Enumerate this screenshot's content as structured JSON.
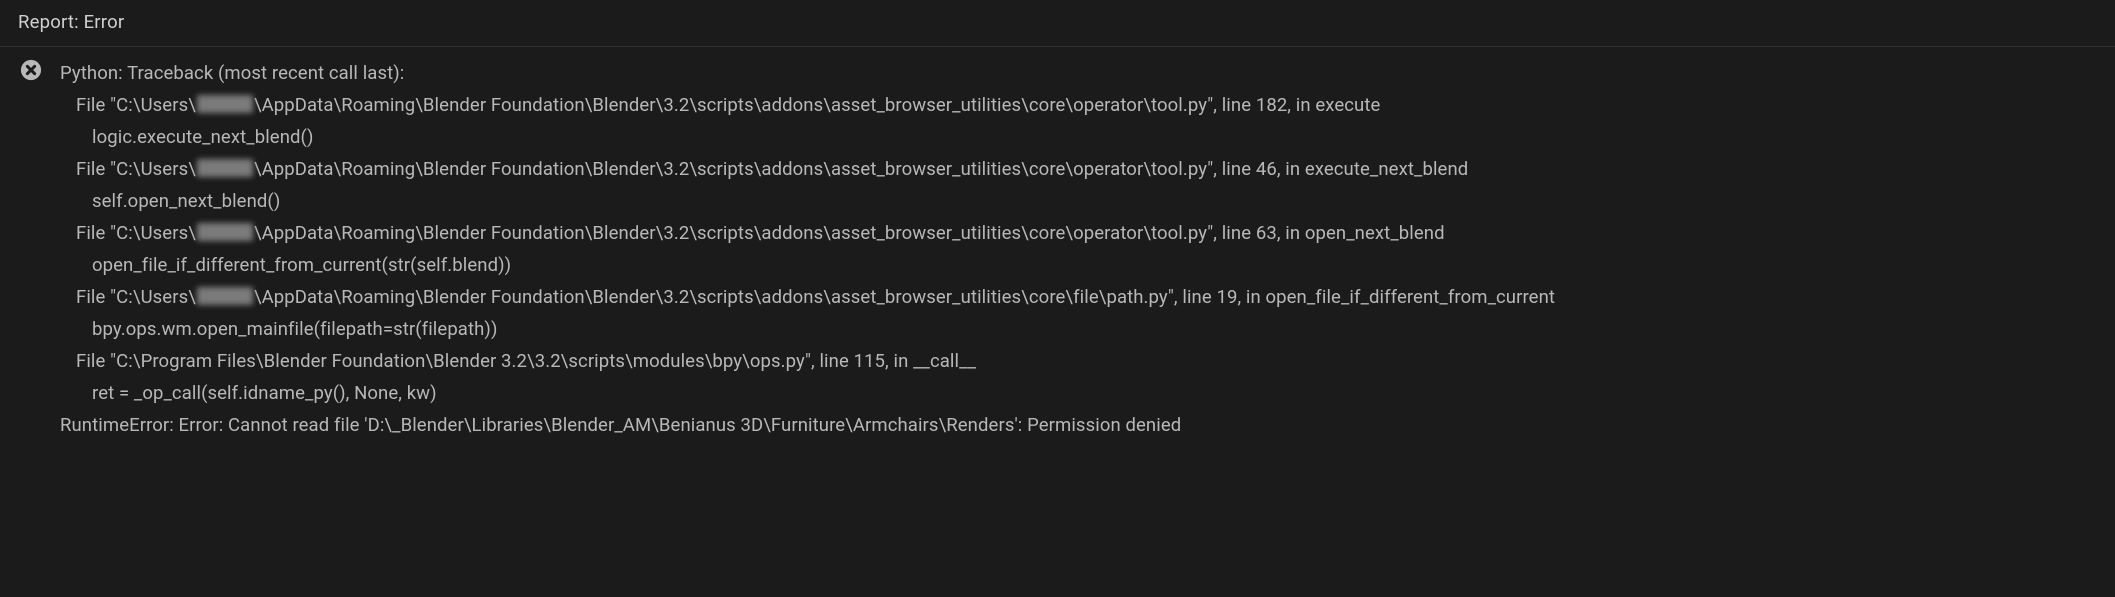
{
  "header": {
    "title": "Report: Error"
  },
  "message": {
    "icon": "error-circle-x-icon",
    "lines": [
      {
        "indent": 0,
        "segments": [
          "Python: Traceback (most recent call last):"
        ]
      },
      {
        "indent": 1,
        "segments": [
          "File \"C:\\Users\\",
          {
            "redacted": true
          },
          "\\AppData\\Roaming\\Blender Foundation\\Blender\\3.2\\scripts\\addons\\asset_browser_utilities\\core\\operator\\tool.py\", line 182, in execute"
        ]
      },
      {
        "indent": 2,
        "segments": [
          "logic.execute_next_blend()"
        ]
      },
      {
        "indent": 1,
        "segments": [
          "File \"C:\\Users\\",
          {
            "redacted": true
          },
          "\\AppData\\Roaming\\Blender Foundation\\Blender\\3.2\\scripts\\addons\\asset_browser_utilities\\core\\operator\\tool.py\", line 46, in execute_next_blend"
        ]
      },
      {
        "indent": 2,
        "segments": [
          "self.open_next_blend()"
        ]
      },
      {
        "indent": 1,
        "segments": [
          "File \"C:\\Users\\",
          {
            "redacted": true
          },
          "\\AppData\\Roaming\\Blender Foundation\\Blender\\3.2\\scripts\\addons\\asset_browser_utilities\\core\\operator\\tool.py\", line 63, in open_next_blend"
        ]
      },
      {
        "indent": 2,
        "segments": [
          "open_file_if_different_from_current(str(self.blend))"
        ]
      },
      {
        "indent": 1,
        "segments": [
          "File \"C:\\Users\\",
          {
            "redacted": true
          },
          "\\AppData\\Roaming\\Blender Foundation\\Blender\\3.2\\scripts\\addons\\asset_browser_utilities\\core\\file\\path.py\", line 19, in open_file_if_different_from_current"
        ]
      },
      {
        "indent": 2,
        "segments": [
          "bpy.ops.wm.open_mainfile(filepath=str(filepath))"
        ]
      },
      {
        "indent": 1,
        "segments": [
          "File \"C:\\Program Files\\Blender Foundation\\Blender 3.2\\3.2\\scripts\\modules\\bpy\\ops.py\", line 115, in __call__"
        ]
      },
      {
        "indent": 2,
        "segments": [
          "ret = _op_call(self.idname_py(), None, kw)"
        ]
      },
      {
        "indent": 0,
        "segments": [
          "RuntimeError: Error: Cannot read file 'D:\\_Blender\\Libraries\\Blender_AM\\Benianus 3D\\Furniture\\Armchairs\\Renders': Permission denied"
        ]
      }
    ]
  },
  "colors": {
    "bg": "#1b1b1b",
    "text": "#b8b8b8",
    "header_text": "#d0d0d0",
    "divider": "#303030",
    "icon_fill": "#b8b8b8"
  }
}
